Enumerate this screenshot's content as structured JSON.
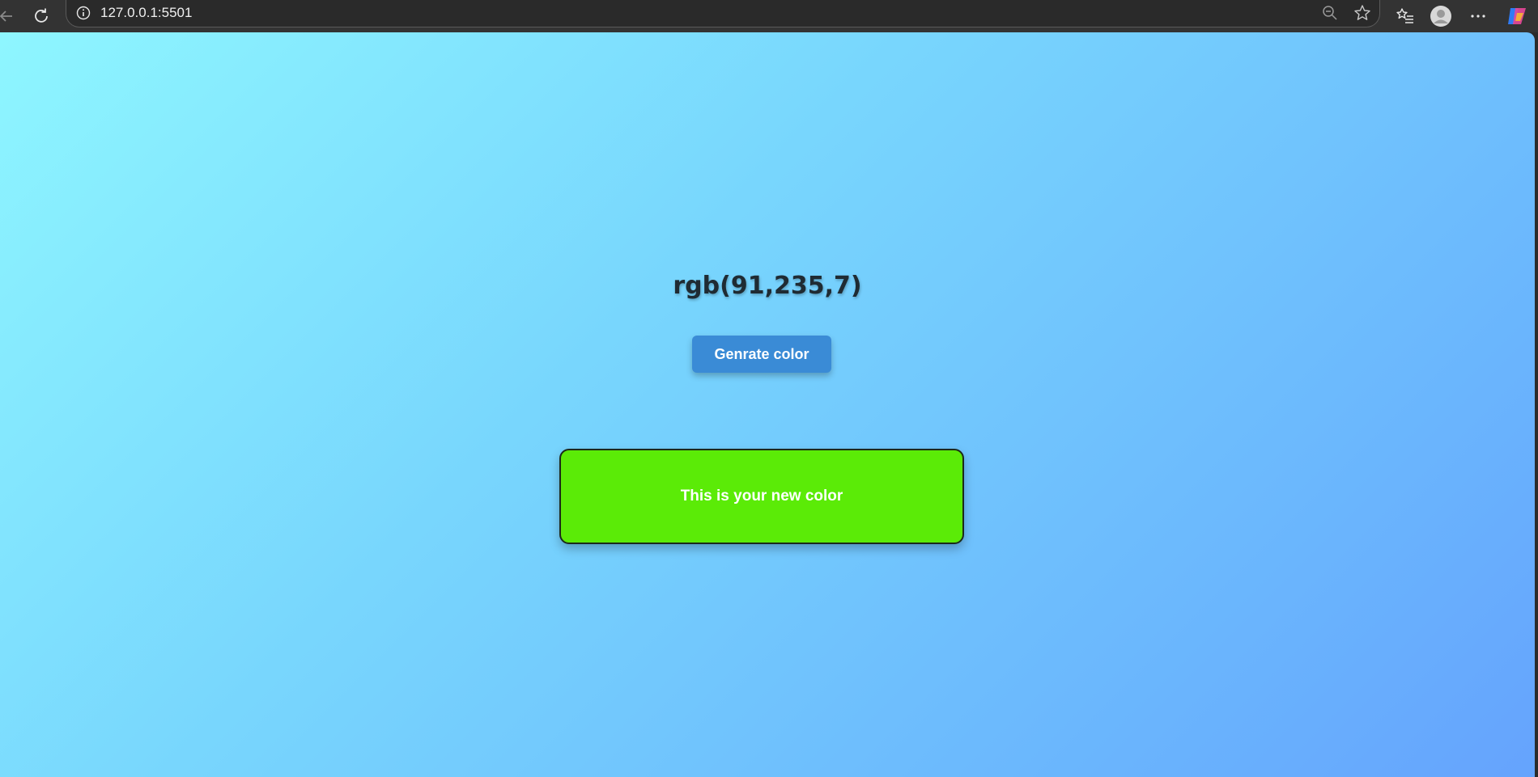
{
  "browser": {
    "url": "127.0.0.1:5501",
    "icons": [
      "back-icon",
      "refresh-icon",
      "site-info-icon",
      "zoom-out-icon",
      "favorite-star-icon",
      "favorites-list-icon",
      "profile-icon",
      "more-options-icon",
      "copilot-icon"
    ]
  },
  "page": {
    "heading": "rgb(91,235,7)",
    "button_label": "Genrate color",
    "box_label": "This is your new color",
    "box_color": "#5beb07",
    "background_gradient": [
      "#8ef6ff",
      "#65a3fd"
    ],
    "button_color": "#3a8bd6"
  }
}
